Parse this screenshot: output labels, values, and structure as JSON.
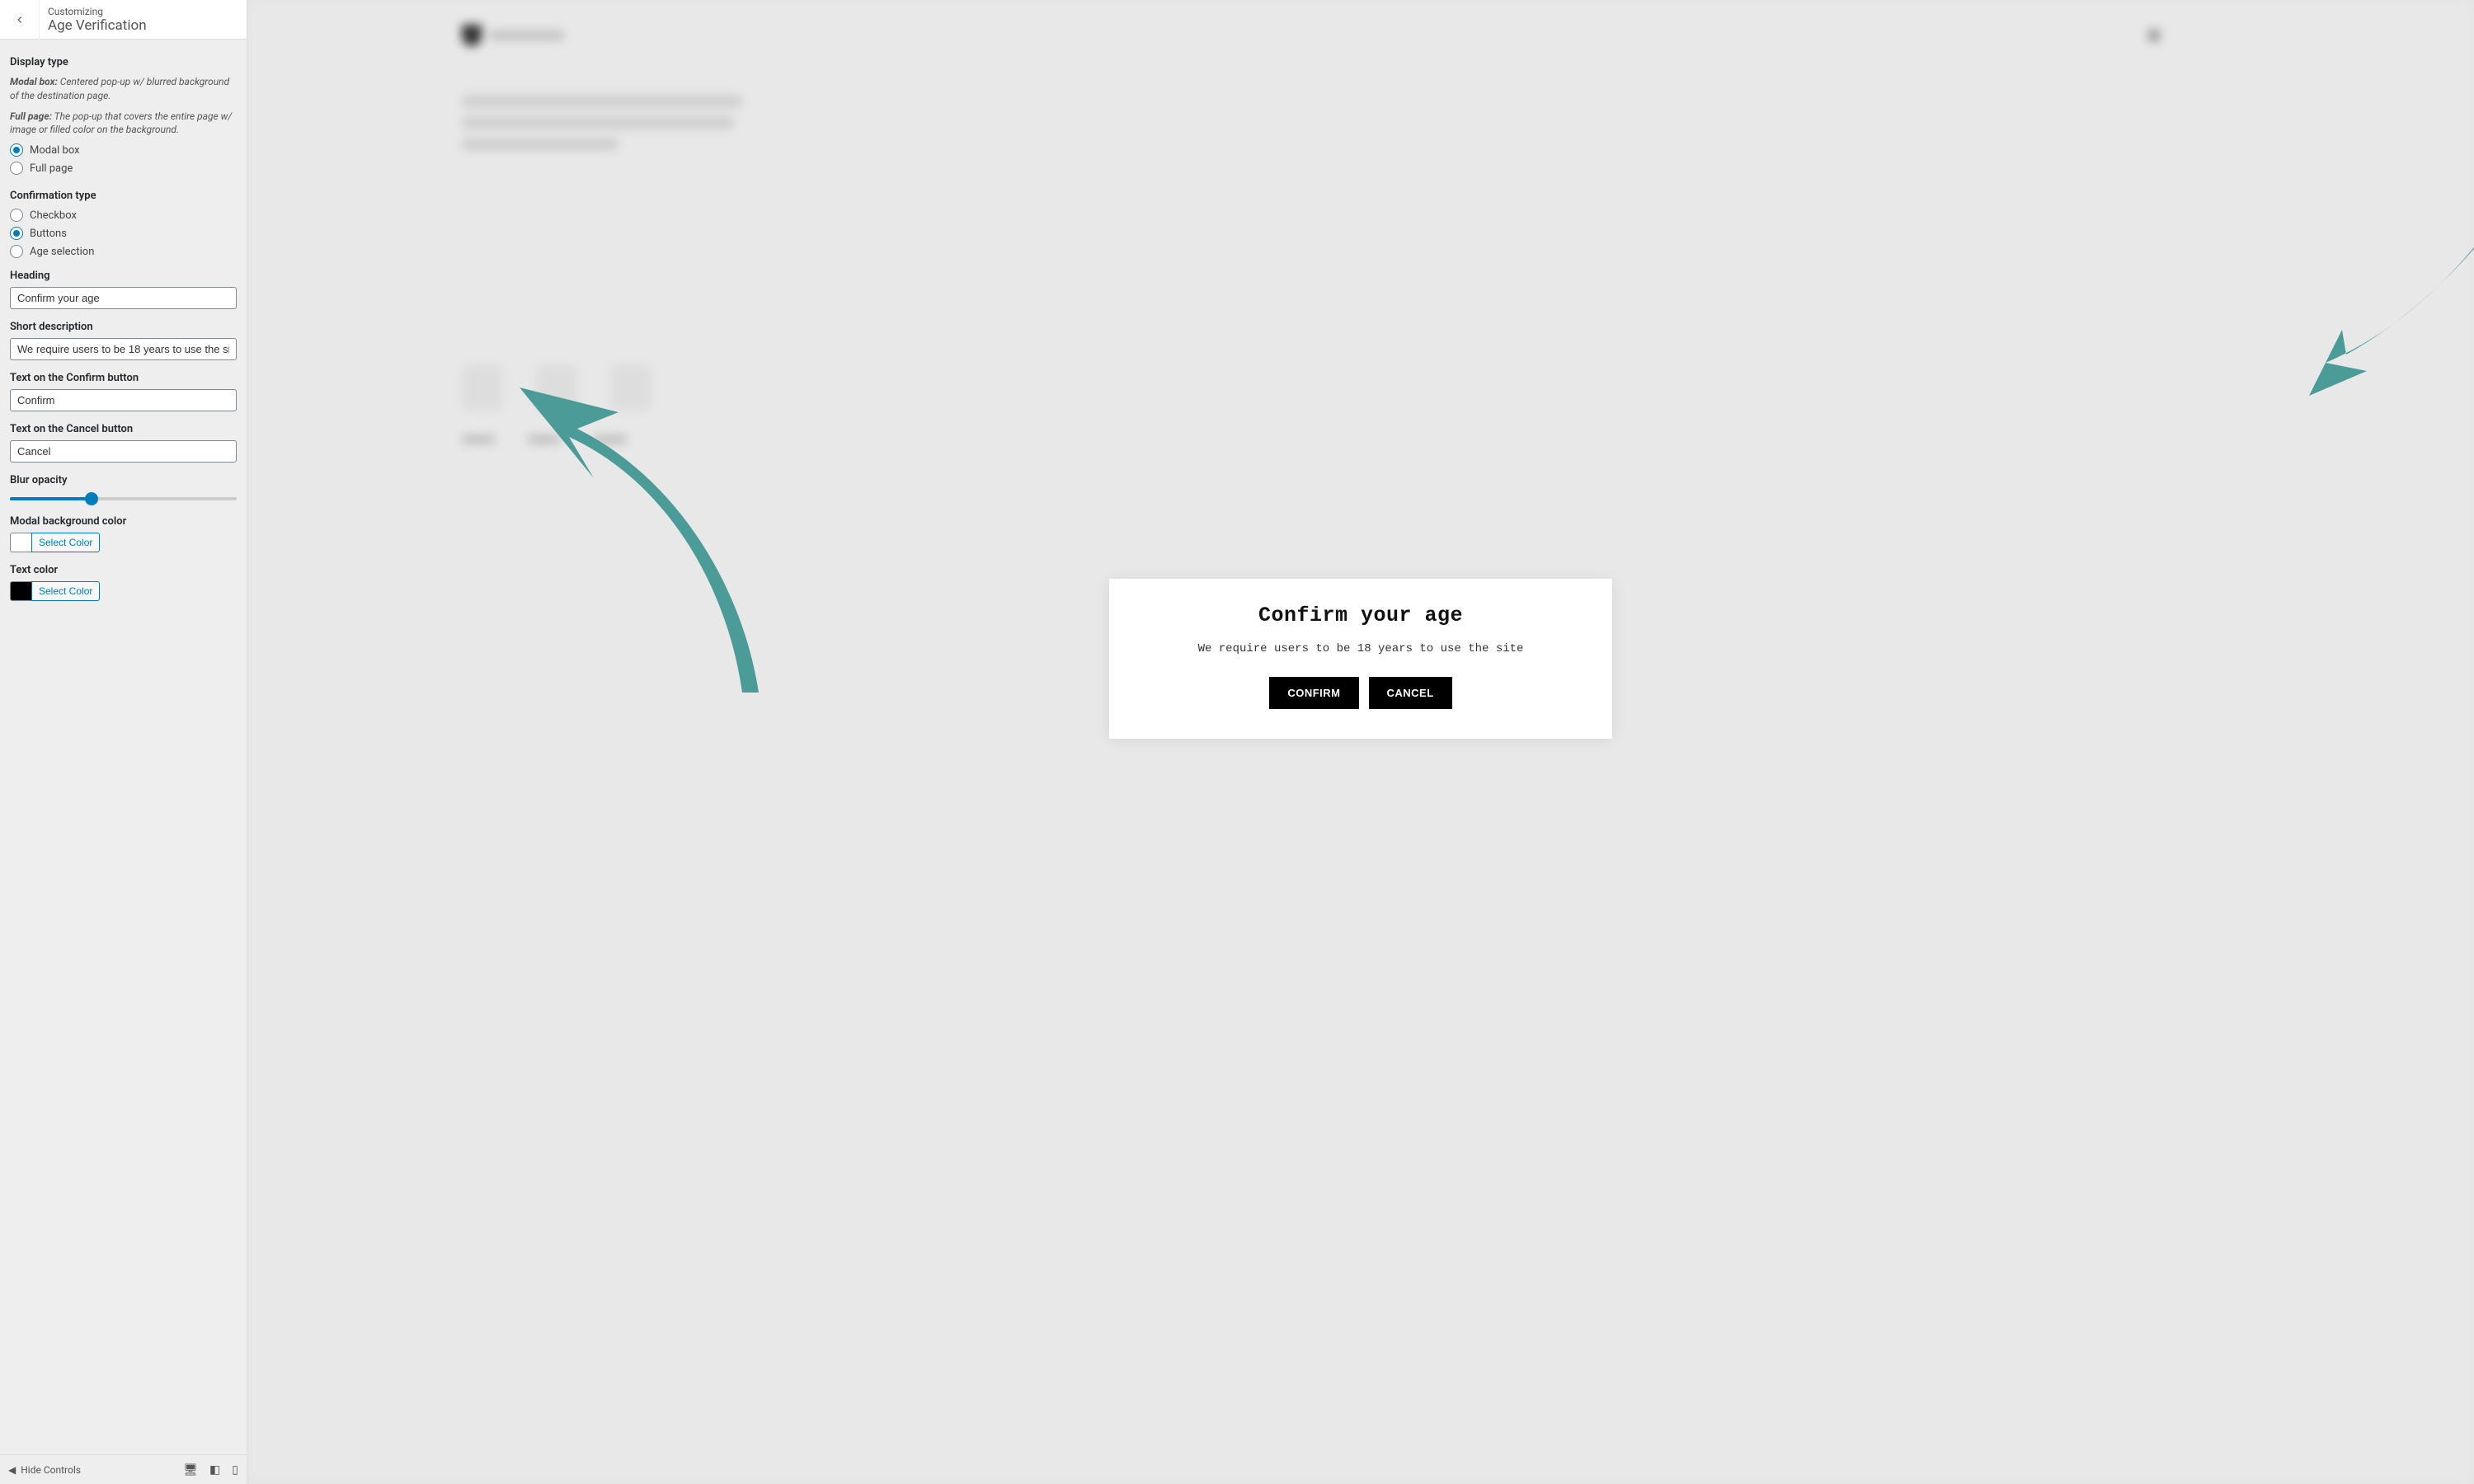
{
  "sidebar": {
    "header": {
      "sub": "Customizing",
      "title": "Age Verification"
    },
    "display_type": {
      "title": "Display type",
      "help_modal_b": "Modal box:",
      "help_modal": " Centered pop-up w/ blurred background of the destination page.",
      "help_full_b": "Full page:",
      "help_full": " The pop-up that covers the entire page w/ image or filled color on the background.",
      "options": {
        "modal": "Modal box",
        "full": "Full page"
      },
      "selected": "modal"
    },
    "confirmation_type": {
      "title": "Confirmation type",
      "options": {
        "checkbox": "Checkbox",
        "buttons": "Buttons",
        "age": "Age selection"
      },
      "selected": "buttons"
    },
    "heading": {
      "label": "Heading",
      "value": "Confirm your age"
    },
    "short_desc": {
      "label": "Short description",
      "value": "We require users to be 18 years to use the site"
    },
    "confirm_btn_text": {
      "label": "Text on the Confirm button",
      "value": "Confirm"
    },
    "cancel_btn_text": {
      "label": "Text on the Cancel button",
      "value": "Cancel"
    },
    "blur": {
      "label": "Blur opacity",
      "value": 35
    },
    "modal_bg": {
      "label": "Modal background color",
      "btn": "Select Color",
      "value": "#ffffff"
    },
    "text_color": {
      "label": "Text color",
      "btn": "Select Color",
      "value": "#000000"
    },
    "footer": {
      "hide": "Hide Controls"
    }
  },
  "preview": {
    "modal": {
      "title": "Confirm your age",
      "desc": "We require users to be 18 years to use the site",
      "confirm": "CONFIRM",
      "cancel": "CANCEL"
    }
  }
}
